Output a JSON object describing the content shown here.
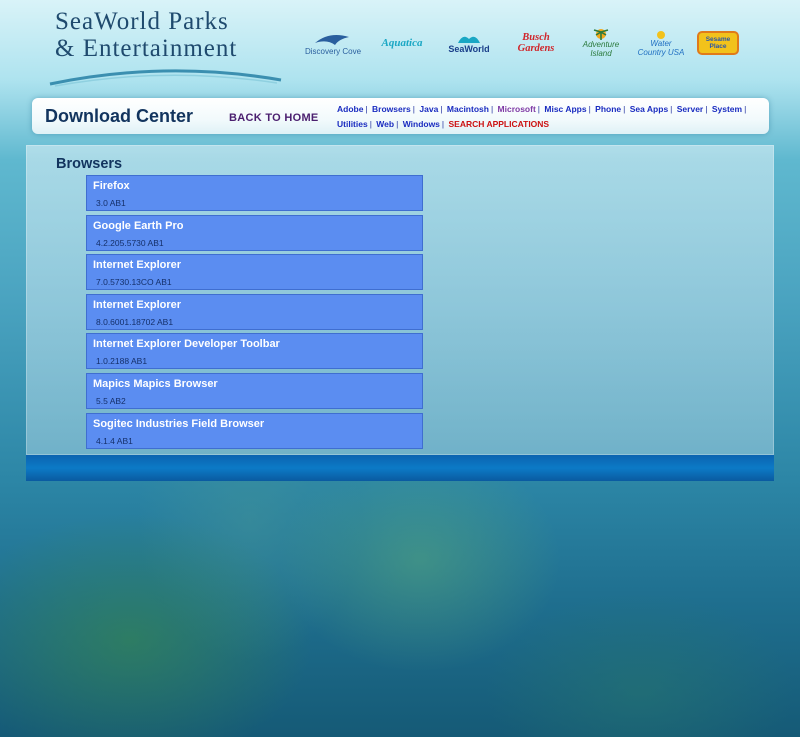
{
  "header": {
    "brand_line1": "SeaWorld Parks",
    "brand_line2": "& Entertainment",
    "parks": [
      {
        "name": "Discovery Cove",
        "color": "#2a5f9e"
      },
      {
        "name": "Aquatica",
        "color": "#1aa7c4"
      },
      {
        "name": "SeaWorld",
        "color": "#1a3f8a"
      },
      {
        "name": "Busch Gardens",
        "color": "#d0262b"
      },
      {
        "name": "Adventure Island",
        "color": "#2b7a3c"
      },
      {
        "name": "Water Country USA",
        "color": "#1f6fc2"
      },
      {
        "name": "Sesame Place",
        "color": "#f2c21b"
      }
    ]
  },
  "nav": {
    "title": "Download Center",
    "back_home": "BACK TO HOME",
    "links": [
      {
        "label": "Adobe",
        "state": "normal"
      },
      {
        "label": "Browsers",
        "state": "normal"
      },
      {
        "label": "Java",
        "state": "normal"
      },
      {
        "label": "Macintosh",
        "state": "normal"
      },
      {
        "label": "Microsoft",
        "state": "visited"
      },
      {
        "label": "Misc Apps",
        "state": "normal"
      },
      {
        "label": "Phone",
        "state": "normal"
      },
      {
        "label": "Sea Apps",
        "state": "normal"
      },
      {
        "label": "Server",
        "state": "normal"
      },
      {
        "label": "System",
        "state": "normal"
      },
      {
        "label": "Utilities",
        "state": "normal"
      },
      {
        "label": "Web",
        "state": "normal"
      },
      {
        "label": "Windows",
        "state": "normal"
      },
      {
        "label": "SEARCH APPLICATIONS",
        "state": "search"
      }
    ]
  },
  "content": {
    "section_title": "Browsers",
    "items": [
      {
        "name": "Firefox",
        "version": "3.0 AB1"
      },
      {
        "name": "Google Earth Pro",
        "version": "4.2.205.5730 AB1"
      },
      {
        "name": "Internet Explorer",
        "version": "7.0.5730.13CO AB1"
      },
      {
        "name": "Internet Explorer",
        "version": "8.0.6001.18702 AB1"
      },
      {
        "name": "Internet Explorer Developer Toolbar",
        "version": "1.0.2188 AB1"
      },
      {
        "name": "Mapics Mapics Browser",
        "version": "5.5 AB2"
      },
      {
        "name": "Sogitec Industries Field Browser",
        "version": "4.1.4 AB1"
      }
    ]
  },
  "colors": {
    "item_bg": "#5b8df1",
    "title_navy": "#12345e",
    "link_blue": "#1a2cc0",
    "link_visited": "#7f3aa5",
    "search_red": "#cc1111"
  }
}
